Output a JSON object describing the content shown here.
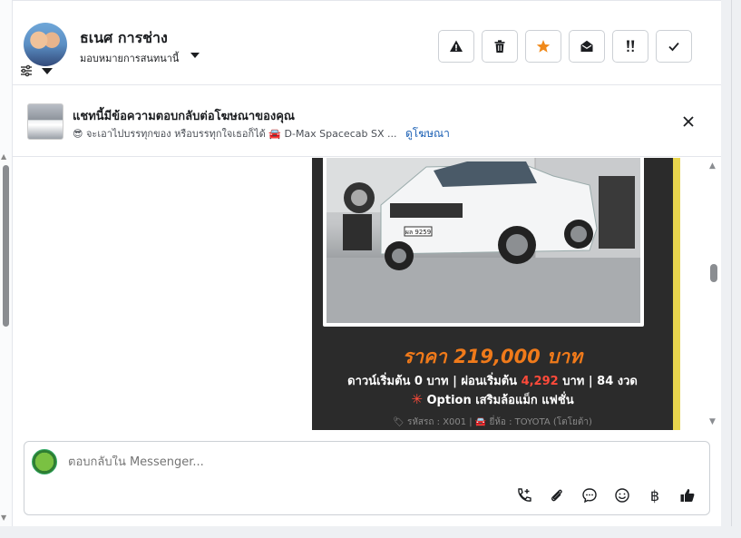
{
  "header": {
    "contact_name": "ธเนศ การช่าง",
    "assign_label": "มอบหมายการสนทนานี้",
    "actions": [
      {
        "name": "spam",
        "icon": "warning-icon"
      },
      {
        "name": "delete",
        "icon": "trash-icon"
      },
      {
        "name": "star",
        "icon": "star-icon"
      },
      {
        "name": "mark-unread",
        "icon": "envelope-open-icon"
      },
      {
        "name": "follow-up",
        "icon": "double-exclamation-icon"
      },
      {
        "name": "done",
        "icon": "check-icon"
      }
    ],
    "accent_star": "#f0891a"
  },
  "ad_bar": {
    "title": "แชทนี้มีข้อความตอบกลับต่อโฆษณาของคุณ",
    "emoji": "😎",
    "subtitle": "จะเอาไปบรรทุกของ หรือบรรทุกใจเธอก็ได้",
    "car_emoji": "🚘",
    "ad_name": "D-Max Spacecab SX ...",
    "link": "ดูโฆษณา"
  },
  "card": {
    "price": "ราคา 219,000 บาท",
    "terms_a": "ดาวน์เริ่มต้น 0 บาท | ผ่อนเริ่มต้น ",
    "terms_red": "4,292",
    "terms_b": " บาท | 84 งวด",
    "option_star": "✳",
    "option": "Option เสริมล้อแม็ก แฟชั่น",
    "code": "รหัสรถ : X001 | 🚘 ยี่ห้อ : TOYOTA (โตโยต้า)",
    "plate": "ผล 9259",
    "border_color": "#e8d44d",
    "price_color": "#f07a1a"
  },
  "composer": {
    "placeholder": "ตอบกลับใน Messenger...",
    "icons": [
      "phone-add-icon",
      "paperclip-icon",
      "saved-reply-icon",
      "emoji-icon",
      "baht-icon",
      "thumbs-up-icon"
    ],
    "baht": "฿"
  }
}
